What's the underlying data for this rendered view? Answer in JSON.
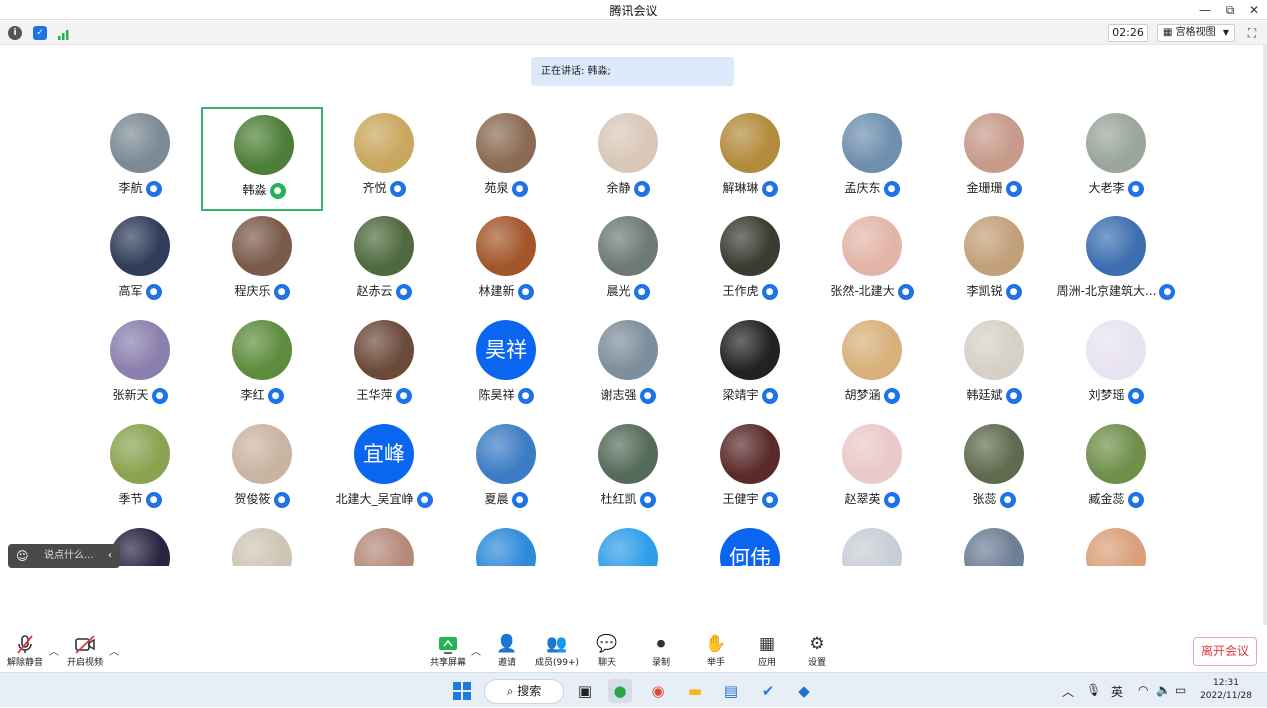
{
  "window": {
    "title": "腾讯会议",
    "minimize": "—",
    "restore": "⧉",
    "close": "✕"
  },
  "topbar": {
    "timer": "02:26",
    "view_label": "宫格视图"
  },
  "speaking": "正在讲话: 韩淼;",
  "participants": [
    {
      "name": "李航"
    },
    {
      "name": "韩淼",
      "active": true
    },
    {
      "name": "齐悦"
    },
    {
      "name": "苑泉"
    },
    {
      "name": "余静"
    },
    {
      "name": "解琳琳"
    },
    {
      "name": "孟庆东"
    },
    {
      "name": "金珊珊"
    },
    {
      "name": "大老李"
    },
    {
      "name": "高军"
    },
    {
      "name": "程庆乐"
    },
    {
      "name": "赵赤云"
    },
    {
      "name": "林建新"
    },
    {
      "name": "晨光"
    },
    {
      "name": "王作虎"
    },
    {
      "name": "张然-北建大"
    },
    {
      "name": "李凯锐"
    },
    {
      "name": "周洲-北京建筑大..."
    },
    {
      "name": "张新天"
    },
    {
      "name": "李红"
    },
    {
      "name": "王华萍"
    },
    {
      "name": "陈昊祥",
      "avatar_text": "昊祥"
    },
    {
      "name": "谢志强"
    },
    {
      "name": "梁靖宇"
    },
    {
      "name": "胡梦涵"
    },
    {
      "name": "韩廷斌"
    },
    {
      "name": "刘梦瑶"
    },
    {
      "name": "季节"
    },
    {
      "name": "贺俊筱"
    },
    {
      "name": "北建大_吴宜峥",
      "avatar_text": "宜峰"
    },
    {
      "name": "夏晨"
    },
    {
      "name": "杜红凯"
    },
    {
      "name": "王健宇"
    },
    {
      "name": "赵翠英"
    },
    {
      "name": "张蕊"
    },
    {
      "name": "臧金蕊"
    },
    {
      "name": ""
    },
    {
      "name": ""
    },
    {
      "name": ""
    },
    {
      "name": ""
    },
    {
      "name": ""
    },
    {
      "name": "",
      "avatar_text": "何伟"
    },
    {
      "name": ""
    },
    {
      "name": ""
    },
    {
      "name": ""
    }
  ],
  "chat_placeholder": "说点什么...",
  "controls": {
    "unmute": "解除静音",
    "start_video": "开启视频",
    "share": "共享屏幕",
    "invite": "邀请",
    "members": "成员(99+)",
    "chat": "聊天",
    "record": "录制",
    "raise_hand": "举手",
    "apps": "应用",
    "settings": "设置",
    "leave": "离开会议"
  },
  "taskbar": {
    "search": "搜索",
    "ime": "英",
    "time": "12:31",
    "date": "2022/11/28"
  }
}
